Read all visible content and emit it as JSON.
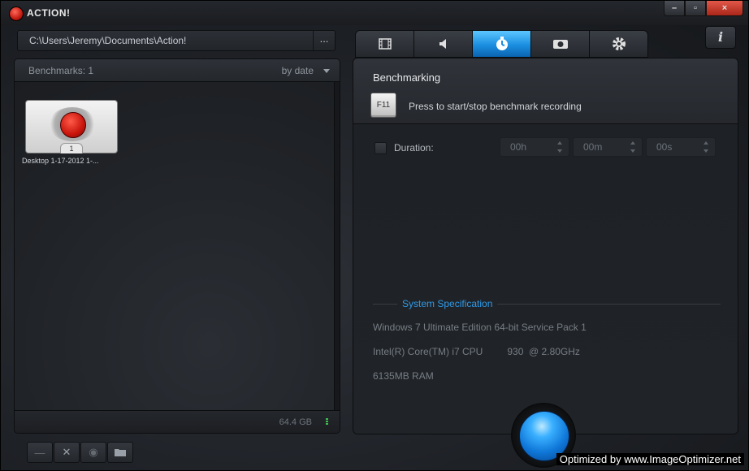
{
  "window": {
    "title": "ACTION!",
    "controls": {
      "minimize": "–",
      "maximize": "▫",
      "close": "×"
    }
  },
  "path_bar": {
    "path": "C:\\Users\\Jeremy\\Documents\\Action!",
    "browse_label": "..."
  },
  "benchmarks_panel": {
    "count_label": "Benchmarks: 1",
    "sort_label": "by date",
    "items": [
      {
        "label": "Desktop 1-17-2012 1-...",
        "badge": "1"
      }
    ],
    "disk_free": "64.4 GB"
  },
  "tabs": [
    {
      "name": "video",
      "icon": "film-icon",
      "active": false
    },
    {
      "name": "audio",
      "icon": "speaker-icon",
      "active": false
    },
    {
      "name": "benchmark",
      "icon": "stopwatch-icon",
      "active": true
    },
    {
      "name": "screenshot",
      "icon": "camera-icon",
      "active": false
    },
    {
      "name": "settings",
      "icon": "gear-icon",
      "active": false
    }
  ],
  "info_button": "i",
  "benchmarking": {
    "title": "Benchmarking",
    "hotkey": "F11",
    "hotkey_desc": "Press to start/stop benchmark recording",
    "duration_label": "Duration:",
    "duration": {
      "hours": "00h",
      "minutes": "00m",
      "seconds": "00s"
    }
  },
  "system_spec": {
    "title": "System Specification",
    "os": "Windows 7 Ultimate Edition 64-bit Service Pack 1",
    "cpu": "Intel(R) Core(TM) i7 CPU         930  @ 2.80GHz",
    "ram": "6135MB RAM"
  },
  "watermark": "Optimized by www.ImageOptimizer.net",
  "colors": {
    "accent": "#1a8ee0",
    "record": "#c8140a",
    "spec_title": "#2f9ae8"
  }
}
